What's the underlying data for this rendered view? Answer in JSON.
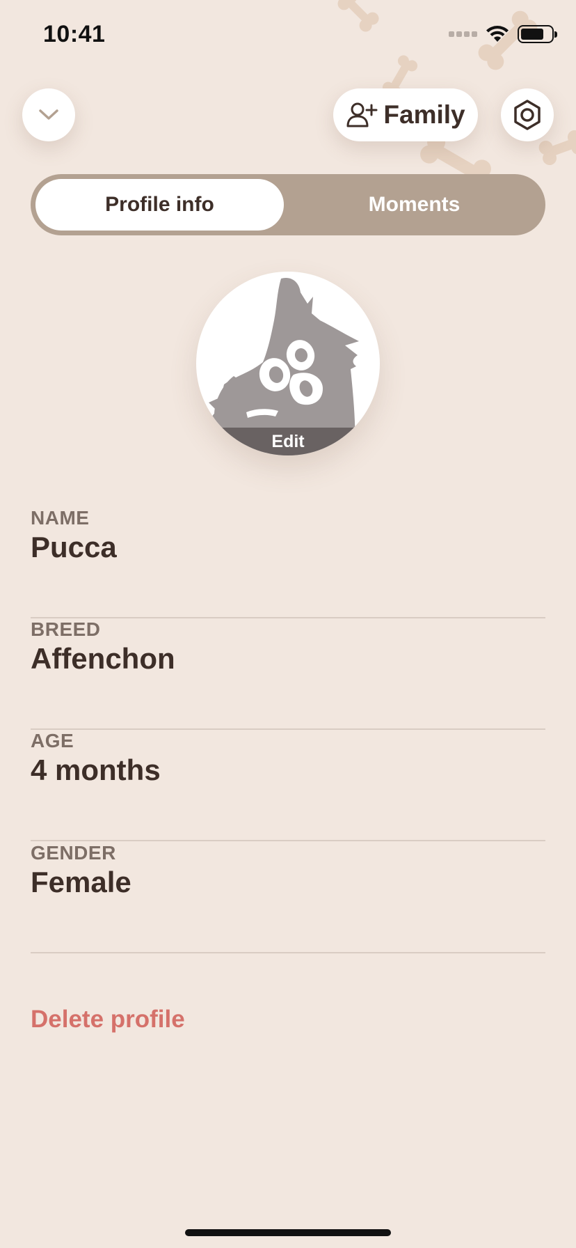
{
  "status_bar": {
    "time": "10:41",
    "icons": [
      "cellular-icon",
      "wifi-icon",
      "battery-icon"
    ]
  },
  "top_bar": {
    "collapse_icon": "chevron-down-icon",
    "family_button": {
      "label": "Family",
      "icon": "add-person-icon"
    },
    "settings_icon": "gear-hexagon-icon"
  },
  "tabs": [
    {
      "label": "Profile info",
      "active": true
    },
    {
      "label": "Moments",
      "active": false
    }
  ],
  "avatar": {
    "edit_label": "Edit"
  },
  "fields": [
    {
      "label": "NAME",
      "value": "Pucca"
    },
    {
      "label": "BREED",
      "value": "Affenchon"
    },
    {
      "label": "AGE",
      "value": "4 months"
    },
    {
      "label": "GENDER",
      "value": "Female"
    }
  ],
  "delete_label": "Delete profile",
  "colors": {
    "background": "#f2e7df",
    "segment_track": "#b3a191",
    "text_primary": "#3d2e28",
    "label_muted": "#7d6e66",
    "danger": "#d5716a",
    "bone_pattern": "#e6d2c1"
  }
}
